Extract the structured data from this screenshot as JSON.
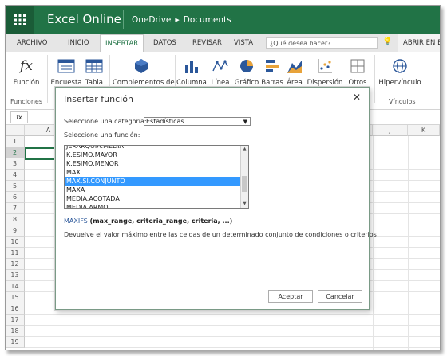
{
  "app": {
    "name": "Excel Online",
    "location": "OneDrive",
    "folder": "Documents"
  },
  "tabs": [
    {
      "label": "ARCHIVO"
    },
    {
      "label": "INICIO"
    },
    {
      "label": "INSERTAR",
      "active": true
    },
    {
      "label": "DATOS"
    },
    {
      "label": "REVISAR"
    },
    {
      "label": "VISTA"
    }
  ],
  "search": {
    "placeholder": "¿Qué desea hacer?"
  },
  "abrir_label": "ABRIR EN E",
  "ribbon": {
    "buttons": [
      {
        "label": "Función",
        "icon": "fx-icon"
      },
      {
        "label": "Encuesta",
        "icon": "survey-icon"
      },
      {
        "label": "Tabla",
        "icon": "table-icon"
      },
      {
        "label": "Complementos de",
        "icon": "addins-icon"
      },
      {
        "label": "Columna",
        "icon": "column-chart-icon"
      },
      {
        "label": "Línea",
        "icon": "line-chart-icon"
      },
      {
        "label": "Gráfico",
        "icon": "pie-chart-icon"
      },
      {
        "label": "Barras",
        "icon": "bar-chart-icon"
      },
      {
        "label": "Área",
        "icon": "area-chart-icon"
      },
      {
        "label": "Dispersión",
        "icon": "scatter-chart-icon"
      },
      {
        "label": "Otros",
        "icon": "other-charts-icon"
      },
      {
        "label": "Hipervínculo",
        "icon": "hyperlink-icon"
      }
    ],
    "groups": {
      "funciones": "Funciones",
      "vinculos": "Vínculos"
    }
  },
  "formula_bar": {
    "fx_label": "fx"
  },
  "grid": {
    "columns": [
      "A",
      "J",
      "K"
    ],
    "rows": [
      "1",
      "2",
      "3",
      "4",
      "5",
      "6",
      "7",
      "8",
      "9",
      "10",
      "11",
      "12",
      "13",
      "14",
      "15",
      "16",
      "17",
      "18",
      "19"
    ],
    "selected_row": "2"
  },
  "dialog": {
    "title": "Insertar función",
    "category_label": "Seleccione una categoría:",
    "category_value": "Estadísticas",
    "function_label": "Seleccione una función:",
    "functions": [
      "JERARQUIA.MEDIA",
      "K.ESIMO.MAYOR",
      "K.ESIMO.MENOR",
      "MAX",
      "MAX.SI.CONJUNTO",
      "MAXA",
      "MEDIA.ACOTADA",
      "MEDIA.ARMO"
    ],
    "selected_function": "MAX.SI.CONJUNTO",
    "syntax_name": "MAXIFS",
    "syntax_args": " (max_range, criteria_range, criteria, ...)",
    "description": "Devuelve el valor máximo entre las celdas de un determinado conjunto de condiciones o criterios",
    "ok_label": "Aceptar",
    "cancel_label": "Cancelar"
  },
  "colors": {
    "excel_green": "#217346",
    "selection_blue": "#3399ff"
  }
}
